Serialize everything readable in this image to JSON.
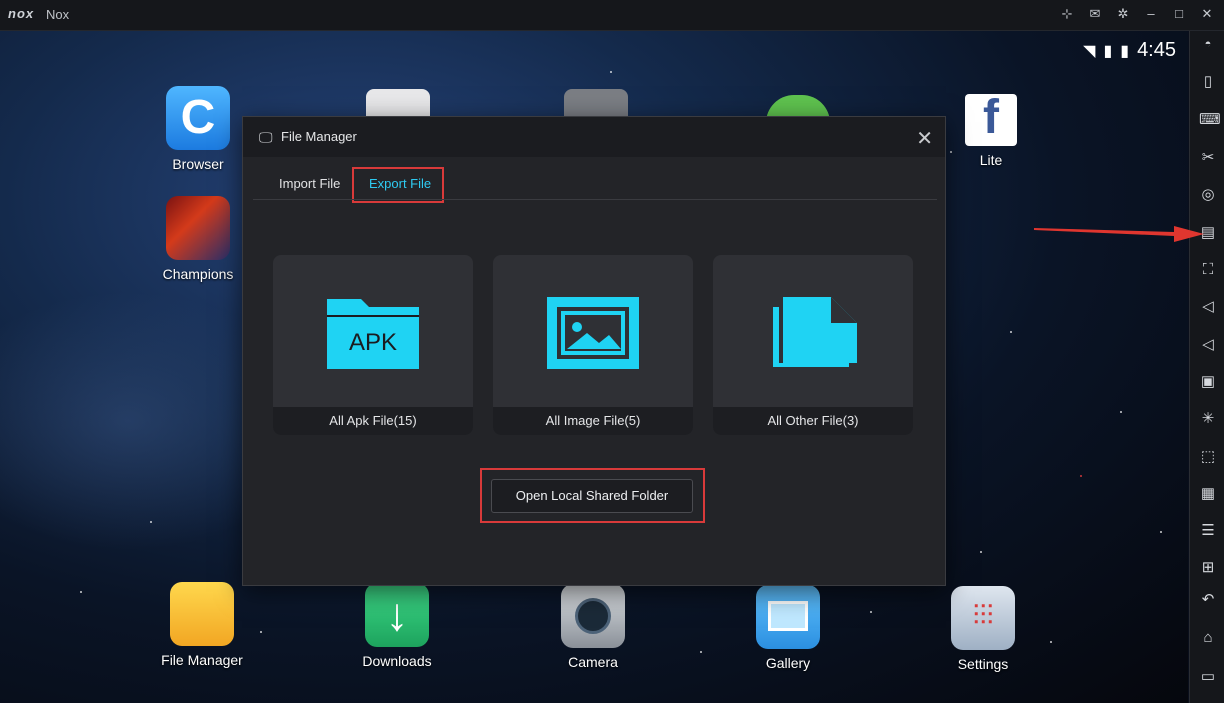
{
  "window": {
    "logo": "nox",
    "title": "Nox",
    "controls": [
      "pin-icon",
      "mail-icon",
      "gear-icon",
      "minimize-icon",
      "maximize-icon",
      "close-icon"
    ]
  },
  "status_bar": {
    "time": "4:45"
  },
  "desktop_apps": [
    {
      "label": "Browser"
    },
    {
      "label": "Champions"
    },
    {
      "label": "Lite"
    }
  ],
  "dock_apps": [
    {
      "label": "File Manager"
    },
    {
      "label": "Downloads"
    },
    {
      "label": "Camera"
    },
    {
      "label": "Gallery"
    },
    {
      "label": "Settings"
    }
  ],
  "dialog": {
    "title": "File Manager",
    "tabs": {
      "import": "Import File",
      "export": "Export File"
    },
    "active_tab": "export",
    "cards": [
      {
        "icon_text": "APK",
        "label": "All Apk File(15)"
      },
      {
        "icon_text": "",
        "label": "All Image File(5)"
      },
      {
        "icon_text": "",
        "label": "All Other File(3)"
      }
    ],
    "open_button": "Open Local Shared Folder"
  },
  "colors": {
    "accent": "#2ecbf2",
    "highlight": "#d83a3a"
  }
}
